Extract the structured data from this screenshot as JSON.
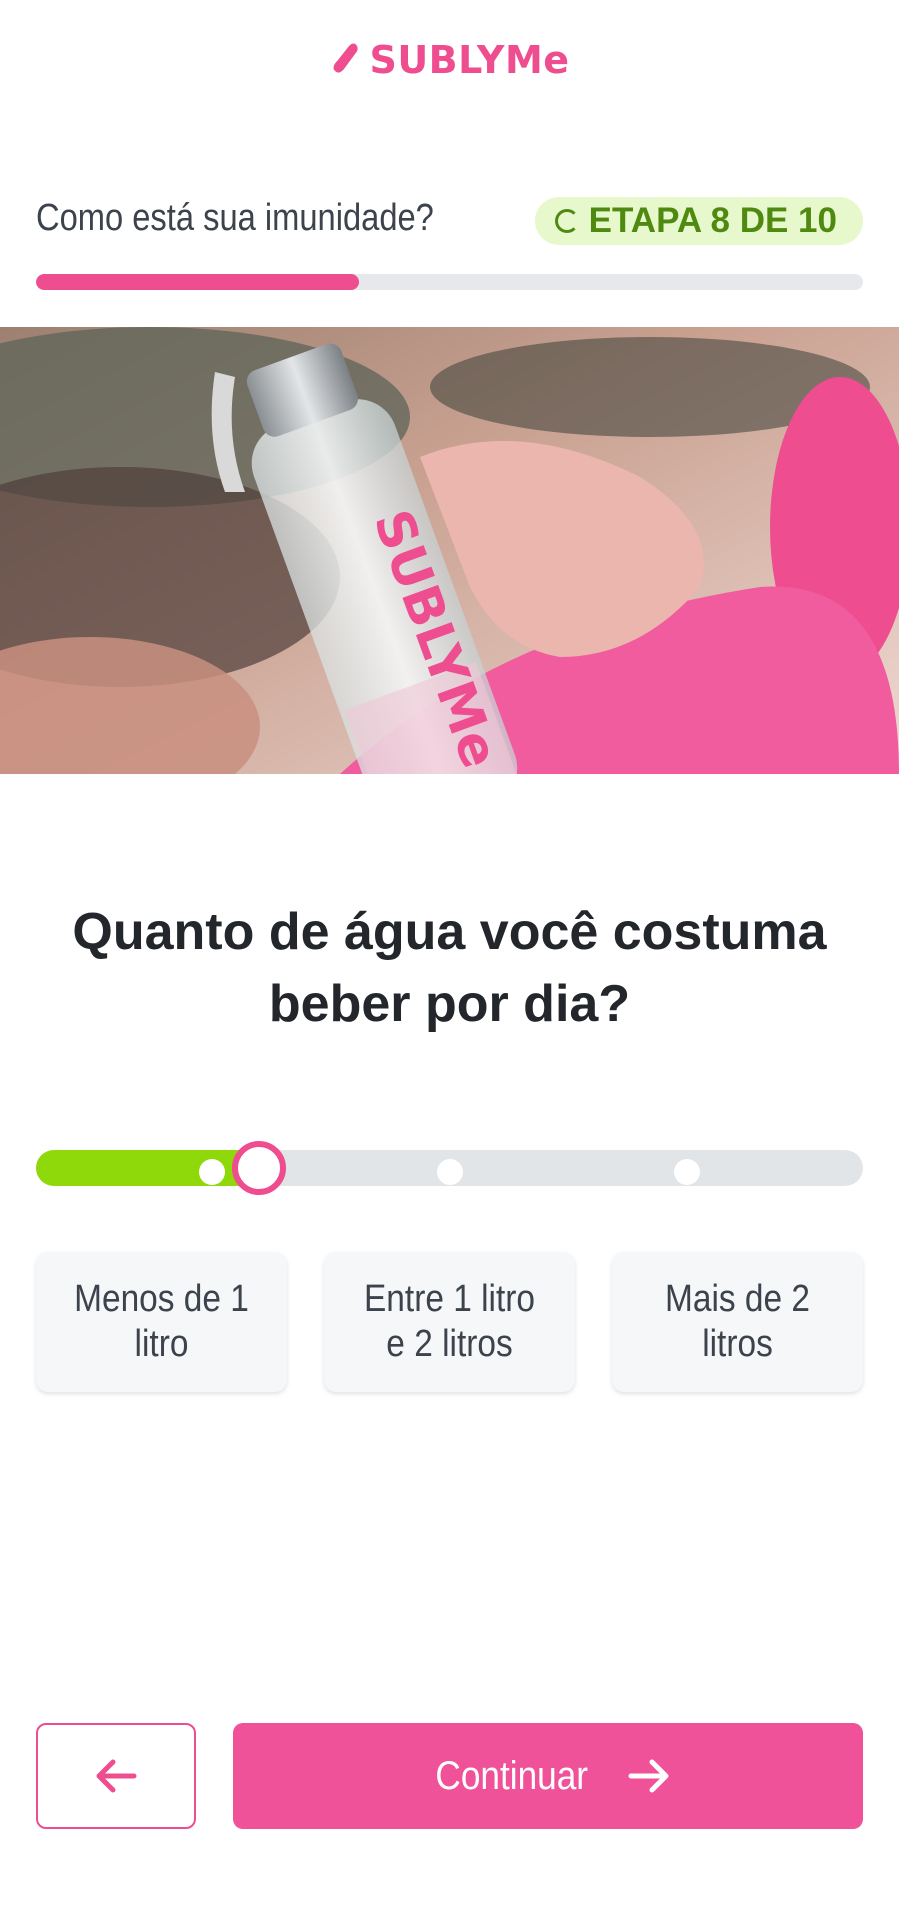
{
  "brand": {
    "name": "SUBLYMe",
    "color": "#ee4d8f"
  },
  "header": {
    "step_title": "Como está sua imunidade?",
    "step_badge": "ETAPA 8 DE 10",
    "progress_fraction": 0.39
  },
  "hero": {
    "bottle_text": "SUBLYMe"
  },
  "question": "Quanto de água você costuma beber por dia?",
  "slider": {
    "fill_color": "#8fd80a",
    "thumb_color": "#ee4d8f",
    "selected_fraction": 0.27,
    "stop_fractions": [
      0.213,
      0.5,
      0.787
    ]
  },
  "options": [
    {
      "label": "Menos de 1 litro"
    },
    {
      "label": "Entre 1 litro e 2 litros"
    },
    {
      "label": "Mais de 2 litros"
    }
  ],
  "footer": {
    "back_icon": "arrow-left-icon",
    "continue_label": "Continuar",
    "continue_icon": "arrow-right-icon"
  }
}
